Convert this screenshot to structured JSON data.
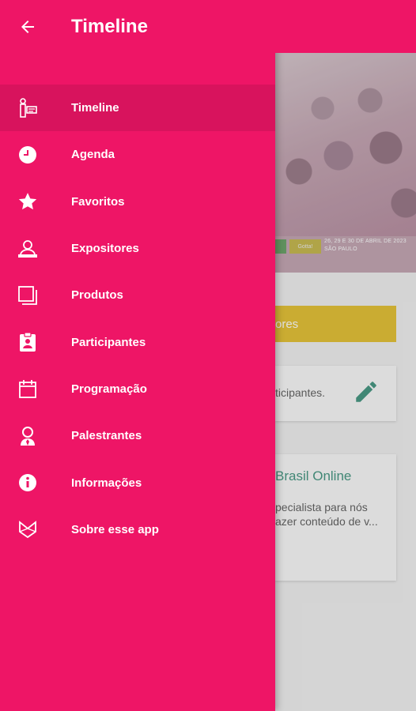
{
  "appbar": {
    "title": "Timeline",
    "back_icon": "arrow-left-icon"
  },
  "colors": {
    "primary": "#ee1566",
    "active_item": "#d8135d",
    "accent_yellow": "#e6c43a",
    "accent_green": "#4a9a86"
  },
  "menu": {
    "items": [
      {
        "label": "Timeline",
        "icon": "timeline-icon",
        "active": true
      },
      {
        "label": "Agenda",
        "icon": "clock-icon",
        "active": false
      },
      {
        "label": "Favoritos",
        "icon": "star-icon",
        "active": false
      },
      {
        "label": "Expositores",
        "icon": "exhibitor-icon",
        "active": false
      },
      {
        "label": "Produtos",
        "icon": "products-icon",
        "active": false
      },
      {
        "label": "Participantes",
        "icon": "badge-icon",
        "active": false
      },
      {
        "label": "Programação",
        "icon": "calendar-icon",
        "active": false
      },
      {
        "label": "Palestrantes",
        "icon": "speaker-icon",
        "active": false
      },
      {
        "label": "Informações",
        "icon": "info-icon",
        "active": false
      },
      {
        "label": "Sobre esse app",
        "icon": "app-logo-icon",
        "active": false
      }
    ]
  },
  "background": {
    "banner_date": "26, 29 E 30 DE ABRIL DE 2023",
    "banner_city": "SÃO PAULO",
    "banner_tag": "Gotta!",
    "yellow_bar_text": "ores",
    "card1_text": "ticipantes.",
    "card2_title": "Brasil Online",
    "card2_line1": "pecialista para nós",
    "card2_line2": "azer conteúdo de v..."
  }
}
